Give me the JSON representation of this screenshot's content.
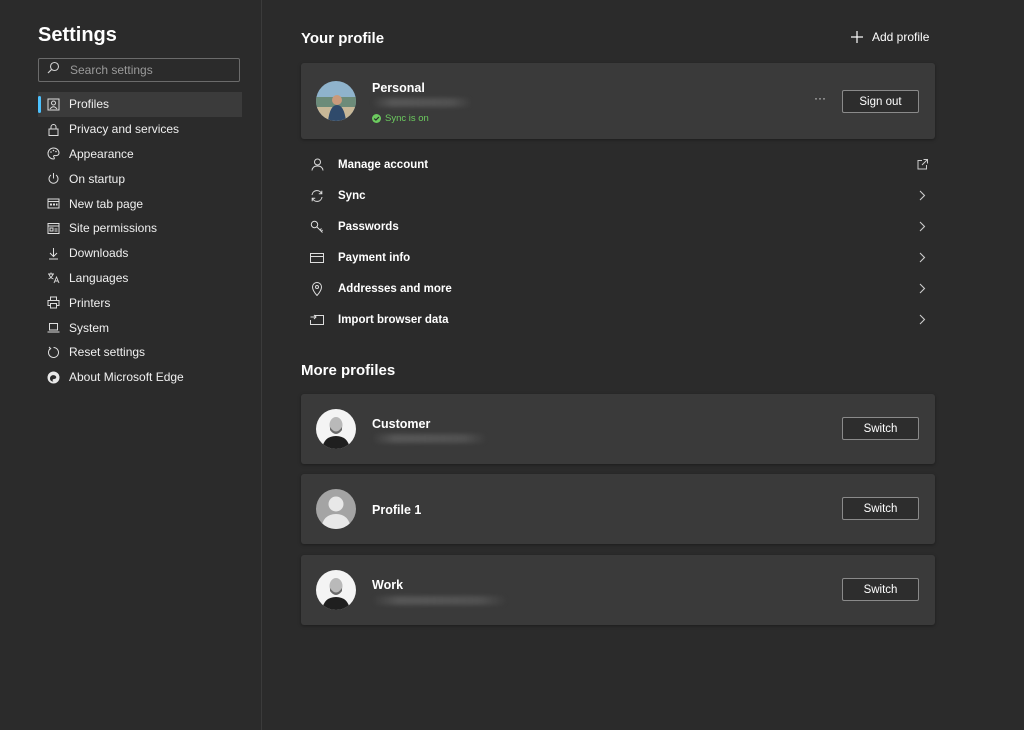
{
  "sidebar": {
    "title": "Settings",
    "search_placeholder": "Search settings",
    "items": [
      {
        "label": "Profiles",
        "icon": "profile-icon",
        "active": true
      },
      {
        "label": "Privacy and services",
        "icon": "lock-icon"
      },
      {
        "label": "Appearance",
        "icon": "palette-icon"
      },
      {
        "label": "On startup",
        "icon": "power-icon"
      },
      {
        "label": "New tab page",
        "icon": "new-tab-icon"
      },
      {
        "label": "Site permissions",
        "icon": "site-permissions-icon"
      },
      {
        "label": "Downloads",
        "icon": "download-icon"
      },
      {
        "label": "Languages",
        "icon": "languages-icon"
      },
      {
        "label": "Printers",
        "icon": "printer-icon"
      },
      {
        "label": "System",
        "icon": "laptop-icon"
      },
      {
        "label": "Reset settings",
        "icon": "reset-icon"
      },
      {
        "label": "About Microsoft Edge",
        "icon": "edge-logo-icon"
      }
    ]
  },
  "your_profile": {
    "heading": "Your profile",
    "add_profile_label": "Add profile",
    "name": "Personal",
    "sync_status": "Sync is on",
    "more_label": "···",
    "sign_out_label": "Sign out"
  },
  "profile_links": [
    {
      "label": "Manage account",
      "icon": "person-icon",
      "end": "external-link-icon"
    },
    {
      "label": "Sync",
      "icon": "sync-icon",
      "end": "chevron-right-icon"
    },
    {
      "label": "Passwords",
      "icon": "key-icon",
      "end": "chevron-right-icon"
    },
    {
      "label": "Payment info",
      "icon": "card-icon",
      "end": "chevron-right-icon"
    },
    {
      "label": "Addresses and more",
      "icon": "location-pin-icon",
      "end": "chevron-right-icon"
    },
    {
      "label": "Import browser data",
      "icon": "import-icon",
      "end": "chevron-right-icon"
    }
  ],
  "more_profiles": {
    "heading": "More profiles",
    "profiles": [
      {
        "name": "Customer",
        "switch_label": "Switch"
      },
      {
        "name": "Profile 1",
        "switch_label": "Switch"
      },
      {
        "name": "Work",
        "switch_label": "Switch"
      }
    ]
  },
  "colors": {
    "background": "#2b2b2b",
    "card": "#3a3a3a",
    "accent": "#4cc2ff",
    "sync_green": "#6ccb5f"
  }
}
